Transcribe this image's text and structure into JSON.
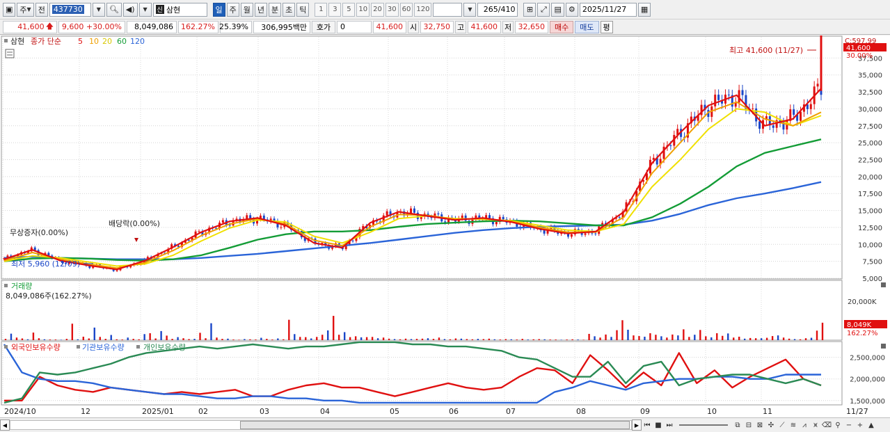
{
  "toolbar": {
    "market_label": "주",
    "prev_label": "전",
    "stock_code": "437730",
    "stock_name": "삼현",
    "shin_badge": "신",
    "period_tabs": [
      "일",
      "주",
      "월",
      "년",
      "분",
      "초",
      "틱"
    ],
    "active_period": "일",
    "intervals": [
      "1",
      "3",
      "5",
      "10",
      "20",
      "30",
      "60",
      "120"
    ],
    "count": "265",
    "total": "/410",
    "date": "2025/11/27"
  },
  "quote": {
    "price": "41,600",
    "change": "9,600",
    "change_pct": "+30.00%",
    "volume": "8,049,086",
    "volume_ratio": "162.27%",
    "turnover": "25.39%",
    "amount": "306,995백만",
    "hoga_label": "호가",
    "hoga_value": "0",
    "hoga_price": "41,600",
    "open_label": "시",
    "open": "32,750",
    "high_label": "고",
    "high": "41,600",
    "low_label": "저",
    "low": "32,650",
    "buy_label": "매수",
    "sell_label": "매도",
    "eval_label": "평"
  },
  "panels": {
    "price": {
      "name": "삼현",
      "ma_label": "종가 단순",
      "ma_periods": [
        {
          "label": "5",
          "color": "#e01010"
        },
        {
          "label": "10",
          "color": "#f0a000"
        },
        {
          "label": "20",
          "color": "#f0e000"
        },
        {
          "label": "60",
          "color": "#139c36"
        },
        {
          "label": "120",
          "color": "#2a64d8"
        }
      ],
      "corner_label": "C:597.99",
      "price_tag": "41,600",
      "pct_tag": "30.00%",
      "high_note": "최고 41,600 (11/27)",
      "low_note": "최저 5,960 (12/09)",
      "event_1": "무상증자(0.00%)",
      "event_2": "배당락(0.00%)"
    },
    "volume": {
      "name": "거래량",
      "value": "8,049,086주(162.27%)",
      "tag": "8,049K",
      "tag_pct": "162.27%",
      "axis_label": "20,000K"
    },
    "holding": {
      "names": [
        "외국인보유수량",
        "기관보유수량",
        "개인보유수량"
      ],
      "colors": [
        "#e01010",
        "#2a64d8",
        "#2a8a54"
      ]
    }
  },
  "chart_data": [
    {
      "type": "line",
      "title": "",
      "x": [
        "2024/10",
        "12",
        "2025/01",
        "02",
        "03",
        "04",
        "05",
        "06",
        "07",
        "08",
        "09",
        "10",
        "11",
        "11/27"
      ],
      "ylim": [
        5000,
        40000
      ],
      "y_ticks": [
        "5,000",
        "7,500",
        "10,000",
        "12,500",
        "15,000",
        "17,500",
        "20,000",
        "22,500",
        "25,000",
        "27,500",
        "30,000",
        "32,500",
        "35,000",
        "37,500"
      ],
      "series": [
        {
          "name": "5",
          "values": [
            7800,
            9200,
            7600,
            6900,
            6300,
            7600,
            9600,
            11800,
            13400,
            13900,
            12800,
            10200,
            9500,
            13200,
            14800,
            14200,
            13600,
            13900,
            13300,
            12300,
            11600,
            11900,
            14800,
            22000,
            26500,
            30500,
            32000,
            27500,
            28500,
            33000
          ]
        },
        {
          "name": "10",
          "values": [
            7600,
            8800,
            7800,
            7100,
            6500,
            7300,
            9100,
            11300,
            13000,
            13800,
            13000,
            10600,
            9800,
            12600,
            14400,
            14300,
            13700,
            13800,
            13400,
            12500,
            11800,
            11800,
            14000,
            20500,
            25000,
            29500,
            31000,
            28500,
            27500,
            29500
          ]
        },
        {
          "name": "20",
          "values": [
            7500,
            8300,
            8000,
            7400,
            6800,
            7100,
            8400,
            10500,
            12400,
            13600,
            13300,
            11200,
            10200,
            11800,
            13800,
            14200,
            13800,
            13700,
            13500,
            12800,
            12100,
            11900,
            13000,
            18500,
            22500,
            27000,
            30000,
            29500,
            27500,
            29000
          ]
        },
        {
          "name": "60",
          "values": [
            7500,
            7900,
            8000,
            7900,
            7700,
            7600,
            7800,
            8400,
            9500,
            10700,
            11500,
            11900,
            11900,
            12100,
            12600,
            13000,
            13200,
            13400,
            13500,
            13400,
            13100,
            12800,
            12800,
            14000,
            16000,
            18500,
            21500,
            23500,
            24500,
            25500
          ]
        },
        {
          "name": "120",
          "values": [
            8000,
            8200,
            8000,
            7900,
            7800,
            7800,
            7800,
            8000,
            8300,
            8600,
            9000,
            9400,
            9800,
            10200,
            10700,
            11200,
            11700,
            12100,
            12400,
            12600,
            12700,
            12800,
            12900,
            13500,
            14500,
            15800,
            16800,
            17500,
            18300,
            19200
          ]
        }
      ]
    },
    {
      "type": "bar",
      "title": "",
      "ylim": [
        0,
        25000
      ],
      "unit": "K",
      "values": [
        600,
        3000,
        1200,
        800,
        400,
        3500,
        900,
        400,
        300,
        300,
        200,
        600,
        7600,
        400,
        1600,
        800,
        5800,
        1500,
        600,
        2400,
        400,
        300,
        1200,
        600,
        400,
        2800,
        3200,
        800,
        4200,
        2100,
        600,
        1400,
        900,
        500,
        600,
        3400,
        900,
        7800,
        1200,
        600,
        700,
        300,
        200,
        500,
        400,
        300,
        1100,
        600,
        300,
        800,
        400,
        9400,
        2800,
        1500,
        1400,
        800,
        1500,
        2500,
        4500,
        11200,
        2500,
        3700,
        1400,
        1800,
        1300,
        1400,
        1500,
        900,
        1200,
        700,
        500,
        400,
        700,
        500,
        600,
        700,
        900,
        600,
        1200,
        500,
        400,
        800,
        700,
        500,
        400,
        600,
        500,
        700,
        400,
        300,
        500,
        400,
        300,
        600,
        300,
        400,
        500,
        400,
        300,
        300,
        200,
        300,
        400,
        300,
        200,
        2900,
        1800,
        1200,
        2600,
        1500,
        4600,
        9200,
        4800,
        2200,
        1900,
        1600,
        3200,
        2500,
        1800,
        1200,
        2600,
        2200,
        5000,
        1500,
        2500,
        4700,
        1800,
        1300,
        3200,
        2000,
        3100,
        1200,
        1600,
        700,
        1000,
        900,
        900,
        1100,
        1900,
        2200,
        1200,
        700,
        500,
        400,
        900,
        1100,
        4400,
        8049
      ]
    },
    {
      "type": "line",
      "title": "",
      "ylim": [
        1400000,
        2800000
      ],
      "y_ticks": [
        "1,500,000",
        "2,000,000",
        "2,500,000"
      ],
      "series": [
        {
          "name": "외국인보유수량",
          "values": [
            1500000,
            1500000,
            2050000,
            1850000,
            1750000,
            1700000,
            1800000,
            1750000,
            1700000,
            1650000,
            1700000,
            1650000,
            1700000,
            1750000,
            1600000,
            1600000,
            1750000,
            1850000,
            1900000,
            1800000,
            1800000,
            1700000,
            1600000,
            1700000,
            1800000,
            1900000,
            1800000,
            1750000,
            1800000,
            2050000,
            2250000,
            2200000,
            1900000,
            2550000,
            2200000,
            1800000,
            2150000,
            1850000,
            2600000,
            1900000,
            2200000,
            1800000,
            2050000,
            2250000,
            2450000,
            2000000,
            1850000
          ]
        },
        {
          "name": "기관보유수량",
          "values": [
            2800000,
            2150000,
            2000000,
            1950000,
            1950000,
            1900000,
            1800000,
            1750000,
            1700000,
            1650000,
            1650000,
            1600000,
            1550000,
            1550000,
            1600000,
            1600000,
            1550000,
            1550000,
            1500000,
            1500000,
            1450000,
            1450000,
            1450000,
            1450000,
            1450000,
            1450000,
            1450000,
            1450000,
            1450000,
            1450000,
            1450000,
            1700000,
            1800000,
            1950000,
            1850000,
            1750000,
            1900000,
            1950000,
            2000000,
            2000000,
            2050000,
            2050000,
            2000000,
            2000000,
            2100000,
            2100000,
            2100000
          ]
        },
        {
          "name": "개인보유수량",
          "values": [
            1450000,
            1550000,
            2150000,
            2100000,
            2150000,
            2250000,
            2350000,
            2500000,
            2600000,
            2650000,
            2700000,
            2750000,
            2700000,
            2750000,
            2800000,
            2750000,
            2700000,
            2750000,
            2750000,
            2800000,
            2850000,
            2850000,
            2850000,
            2800000,
            2800000,
            2750000,
            2750000,
            2700000,
            2650000,
            2500000,
            2450000,
            2250000,
            2050000,
            2050000,
            2400000,
            1900000,
            2300000,
            2400000,
            1850000,
            2000000,
            2050000,
            2100000,
            2100000,
            2000000,
            1900000,
            2000000,
            1850000
          ]
        }
      ]
    }
  ]
}
